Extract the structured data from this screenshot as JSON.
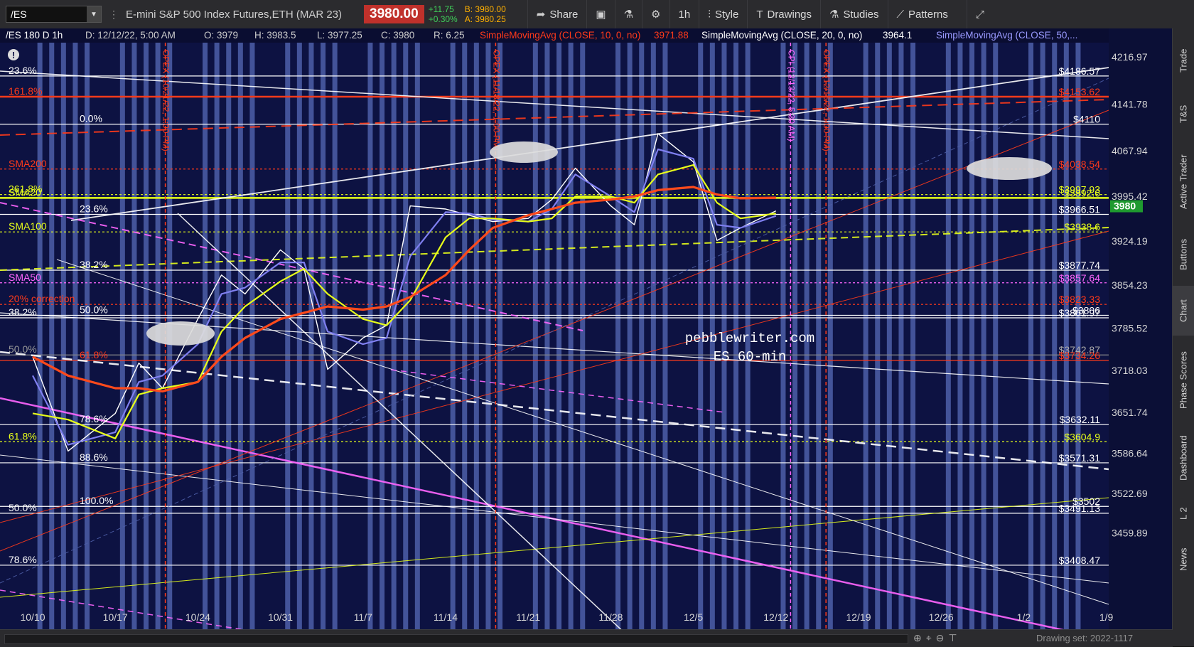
{
  "toolbar": {
    "symbol": "/ES",
    "description": "E-mini S&P 500 Index Futures,ETH (MAR 23)",
    "last": "3980.00",
    "change_abs": "+11.75",
    "change_pct": "+0.30%",
    "bid": "B: 3980.00",
    "ask": "A: 3980.25",
    "buttons": {
      "share": "Share",
      "interval": "1h",
      "style": "Style",
      "drawings": "Drawings",
      "studies": "Studies",
      "patterns": "Patterns"
    }
  },
  "info_bar": {
    "symbol_period": "/ES 180 D 1h",
    "date": "D: 12/12/22, 5:00 AM",
    "open": "O: 3979",
    "high": "H: 3983.5",
    "low": "L: 3977.25",
    "close": "C: 3980",
    "range": "R: 6.25",
    "sma10_label": "SimpleMovingAvg (CLOSE, 10, 0, no)",
    "sma10_value": "3971.88",
    "sma20_label": "SimpleMovingAvg (CLOSE, 20, 0, no)",
    "sma20_value": "3964.1",
    "sma50_label": "SimpleMovingAvg (CLOSE, 50,..."
  },
  "sidebar_tabs": [
    "Trade",
    "T&S",
    "Active Trader",
    "Buttons",
    "Chart",
    "Phase Scores",
    "Dashboard",
    "L 2",
    "News"
  ],
  "drawing_set": "Drawing set: 2022-1117",
  "watermark": [
    "pebblewriter.com",
    "ES 60-min"
  ],
  "colors": {
    "background": "#0d1242",
    "stripe": "#4e5fa8",
    "sma10": "#ffffff",
    "sma20": "#7f7ff0",
    "sma50": "#e8ff1a",
    "sma200": "#ff4a1c",
    "price_tag": "#1f9a2f"
  },
  "chart_data": {
    "type": "line",
    "title": "",
    "xlabel": "",
    "ylabel": "",
    "ylim": [
      3405,
      4235
    ],
    "x_ticks": [
      "10/10",
      "10/17",
      "10/24",
      "10/31",
      "11/7",
      "11/14",
      "11/21",
      "11/28",
      "12/5",
      "12/12",
      "12/19",
      "12/26",
      "1/2",
      "1/9"
    ],
    "y_ticks": [
      4216.97,
      4141.78,
      4067.94,
      3995.42,
      3924.19,
      3854.23,
      3785.52,
      3718.03,
      3651.74,
      3586.64,
      3522.69,
      3459.89
    ],
    "current_price": "3980",
    "series": [
      {
        "name": "SimpleMovingAvg (CLOSE, 10, 0, no)",
        "dates": [
          "10/10",
          "10/13",
          "10/17",
          "10/19",
          "10/21",
          "10/24",
          "10/26",
          "10/28",
          "10/31",
          "11/2",
          "11/4",
          "11/7",
          "11/9",
          "11/11",
          "11/14",
          "11/16",
          "11/18",
          "11/21",
          "11/23",
          "11/25",
          "11/28",
          "11/30",
          "12/2",
          "12/5",
          "12/7",
          "12/9",
          "12/12"
        ],
        "values": [
          3740,
          3590,
          3650,
          3730,
          3690,
          3800,
          3870,
          3840,
          3910,
          3880,
          3720,
          3770,
          3790,
          3980,
          3975,
          3965,
          3955,
          3960,
          3990,
          4040,
          3980,
          3950,
          4095,
          4050,
          3925,
          3945,
          3972
        ]
      },
      {
        "name": "SimpleMovingAvg (CLOSE, 20, 0, no)",
        "dates": [
          "10/10",
          "10/13",
          "10/17",
          "10/19",
          "10/21",
          "10/24",
          "10/26",
          "10/28",
          "10/31",
          "11/2",
          "11/4",
          "11/7",
          "11/9",
          "11/11",
          "11/14",
          "11/16",
          "11/18",
          "11/21",
          "11/23",
          "11/25",
          "11/28",
          "11/30",
          "12/2",
          "12/5",
          "12/7",
          "12/9",
          "12/12"
        ],
        "values": [
          3710,
          3600,
          3620,
          3700,
          3710,
          3760,
          3840,
          3850,
          3890,
          3890,
          3780,
          3760,
          3770,
          3900,
          3970,
          3968,
          3958,
          3955,
          3975,
          4030,
          3995,
          3970,
          4070,
          4055,
          3950,
          3945,
          3964
        ]
      },
      {
        "name": "SMA50",
        "dates": [
          "10/10",
          "10/13",
          "10/17",
          "10/19",
          "10/21",
          "10/24",
          "10/26",
          "10/28",
          "10/31",
          "11/2",
          "11/4",
          "11/7",
          "11/9",
          "11/11",
          "11/14",
          "11/16",
          "11/18",
          "11/21",
          "11/23",
          "11/25",
          "11/28",
          "11/30",
          "12/2",
          "12/5",
          "12/7",
          "12/9",
          "12/12"
        ],
        "values": [
          3650,
          3640,
          3610,
          3680,
          3690,
          3700,
          3780,
          3820,
          3860,
          3880,
          3840,
          3800,
          3790,
          3830,
          3930,
          3960,
          3960,
          3955,
          3960,
          3995,
          3995,
          3985,
          4030,
          4045,
          3985,
          3960,
          3968
        ]
      },
      {
        "name": "SMA200",
        "dates": [
          "10/10",
          "10/13",
          "10/17",
          "10/19",
          "10/21",
          "10/24",
          "10/26",
          "10/28",
          "10/31",
          "11/2",
          "11/4",
          "11/7",
          "11/9",
          "11/11",
          "11/14",
          "11/16",
          "11/18",
          "11/21",
          "11/23",
          "11/25",
          "11/28",
          "11/30",
          "12/2",
          "12/5",
          "12/7",
          "12/9",
          "12/12"
        ],
        "values": [
          3740,
          3710,
          3690,
          3690,
          3685,
          3700,
          3740,
          3770,
          3800,
          3810,
          3820,
          3815,
          3820,
          3835,
          3870,
          3910,
          3945,
          3965,
          3975,
          3985,
          3990,
          3995,
          4005,
          4010,
          3998,
          3992,
          3993
        ]
      }
    ],
    "levels": [
      {
        "value": 4186.57,
        "label": "$4186.57",
        "left_label": "23.6%",
        "color": "#ffffff"
      },
      {
        "value": 4153.62,
        "label": "$4153.62",
        "left_label": "161.8%",
        "color": "#ff3a1a"
      },
      {
        "value": 4110,
        "label": "$4110",
        "left_label": "0.0%",
        "color": "#ffffff"
      },
      {
        "value": 4038.54,
        "label": "$4038.54",
        "left_label": "SMA200",
        "color": "#ff3a1a"
      },
      {
        "value": 3997.93,
        "label": "$3997.93",
        "left_label": "261.8%",
        "color": "#e8ff1a"
      },
      {
        "value": 3992.6,
        "label": "$3992.6",
        "left_label": "SMA20",
        "color": "#e8ff1a"
      },
      {
        "value": 3966.51,
        "label": "$3966.51",
        "left_label": "23.6%",
        "color": "#ffffff"
      },
      {
        "value": 3938.6,
        "label": "$3938.6",
        "left_label": "SMA100",
        "color": "#e8ff1a"
      },
      {
        "value": 3877.74,
        "label": "$3877.74",
        "left_label": "38.2%",
        "color": "#ffffff"
      },
      {
        "value": 3857.64,
        "label": "$3857.64",
        "left_label": "SMA50",
        "color": "#ff66ff"
      },
      {
        "value": 3823.33,
        "label": "$3823.33",
        "left_label": "20% correction",
        "color": "#ff3a1a"
      },
      {
        "value": 3806,
        "label": "$3806",
        "left_label": "50.0%",
        "color": "#ffffff"
      },
      {
        "value": 3801.97,
        "label": "$3801.97",
        "left_label": "38.2%",
        "color": "#ffffff"
      },
      {
        "value": 3742.87,
        "label": "$3742.87",
        "left_label": "50.0%",
        "color": "#888888"
      },
      {
        "value": 3734.26,
        "label": "$3734.26",
        "left_label": "61.8%",
        "color": "#ff3a1a"
      },
      {
        "value": 3632.11,
        "label": "$3632.11",
        "left_label": "78.6%",
        "color": "#ffffff"
      },
      {
        "value": 3604.9,
        "label": "$3604.9",
        "left_label": "61.8%",
        "color": "#e8ff1a"
      },
      {
        "value": 3571.31,
        "label": "$3571.31",
        "left_label": "88.6%",
        "color": "#ffffff"
      },
      {
        "value": 3502,
        "label": "$3502",
        "left_label": "100.0%",
        "color": "#ffffff"
      },
      {
        "value": 3491.13,
        "label": "$3491.13",
        "left_label": "50.0%",
        "color": "#ffffff"
      },
      {
        "value": 3408.47,
        "label": "$3408.47",
        "left_label": "78.6%",
        "color": "#ffffff"
      }
    ],
    "events": [
      {
        "date": "10/21",
        "label": "OPEX (10/21/22, 1:00 PM)",
        "color": "#ff3a1a"
      },
      {
        "date": "11/18",
        "label": "OPEX (11/18/22, 1:00 PM)",
        "color": "#ff3a1a"
      },
      {
        "date": "12/13",
        "label": "CPI (12/13/22, 5:30 AM)",
        "color": "#ff66ff"
      },
      {
        "date": "12/16",
        "label": "OPEX (12/16/22, 1:00 PM)",
        "color": "#ff3a1a"
      }
    ]
  }
}
